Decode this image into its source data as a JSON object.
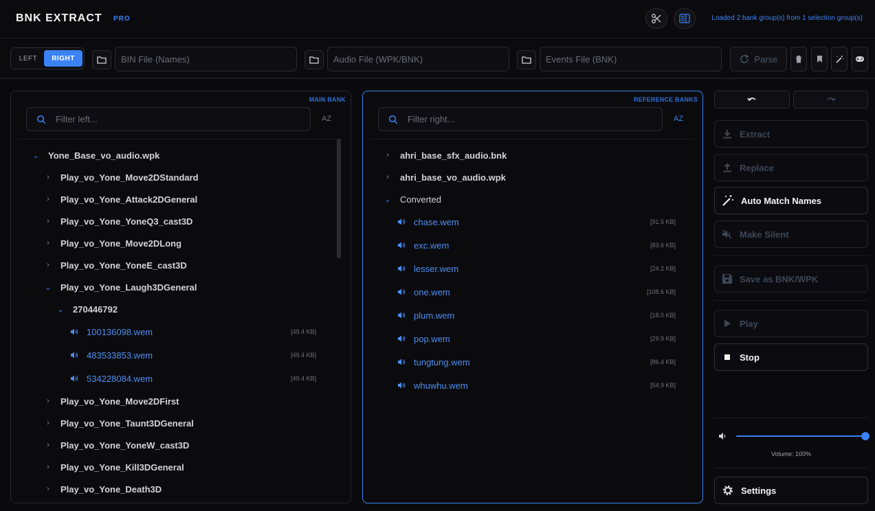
{
  "app": {
    "title": "BNK EXTRACT",
    "tag": "PRO",
    "status": "Loaded 2 bank group(s) from 1 selection group(s)"
  },
  "toolbar": {
    "side_left": "LEFT",
    "side_right": "RIGHT",
    "bin_placeholder": "BIN File (Names)",
    "audio_placeholder": "Audio File (WPK/BNK)",
    "events_placeholder": "Events File (BNK)",
    "parse_label": "Parse"
  },
  "left_panel": {
    "tag": "MAIN BANK",
    "filter_placeholder": "Filter left...",
    "sort_label": "AZ",
    "root": "Yone_Base_vo_audio.wpk",
    "items": [
      "Play_vo_Yone_Move2DStandard",
      "Play_vo_Yone_Attack2DGeneral",
      "Play_vo_Yone_YoneQ3_cast3D",
      "Play_vo_Yone_Move2DLong",
      "Play_vo_Yone_YoneE_cast3D",
      "Play_vo_Yone_Laugh3DGeneral"
    ],
    "sub_id": "270446792",
    "files": [
      {
        "name": "100136098.wem",
        "size": "[49.4 KB]"
      },
      {
        "name": "483533853.wem",
        "size": "[49.4 KB]"
      },
      {
        "name": "534228084.wem",
        "size": "[49.4 KB]"
      }
    ],
    "items_after": [
      "Play_vo_Yone_Move2DFirst",
      "Play_vo_Yone_Taunt3DGeneral",
      "Play_vo_Yone_YoneW_cast3D",
      "Play_vo_Yone_Kill3DGeneral",
      "Play_vo_Yone_Death3D"
    ]
  },
  "right_panel": {
    "tag": "REFERENCE BANKS",
    "filter_placeholder": "Filter right...",
    "sort_label": "AZ",
    "banks": [
      "ahri_base_sfx_audio.bnk",
      "ahri_base_vo_audio.wpk"
    ],
    "folder": "Converted",
    "files": [
      {
        "name": "chase.wem",
        "size": "[91.5 KB]"
      },
      {
        "name": "exc.wem",
        "size": "[83.6 KB]"
      },
      {
        "name": "lesser.wem",
        "size": "[24.2 KB]"
      },
      {
        "name": "one.wem",
        "size": "[108.6 KB]"
      },
      {
        "name": "plum.wem",
        "size": "[18.0 KB]"
      },
      {
        "name": "pop.wem",
        "size": "[29.9 KB]"
      },
      {
        "name": "tungtung.wem",
        "size": "[86.4 KB]"
      },
      {
        "name": "whuwhu.wem",
        "size": "[54.9 KB]"
      }
    ]
  },
  "actions": {
    "extract": "Extract",
    "replace": "Replace",
    "auto_match": "Auto Match Names",
    "make_silent": "Make Silent",
    "save_as": "Save as BNK/WPK",
    "play": "Play",
    "stop": "Stop",
    "settings": "Settings"
  },
  "volume": {
    "label": "Volume: 100%",
    "level": 1.0
  },
  "colors": {
    "accent": "#3b82f6",
    "background": "#0a0a0d"
  }
}
